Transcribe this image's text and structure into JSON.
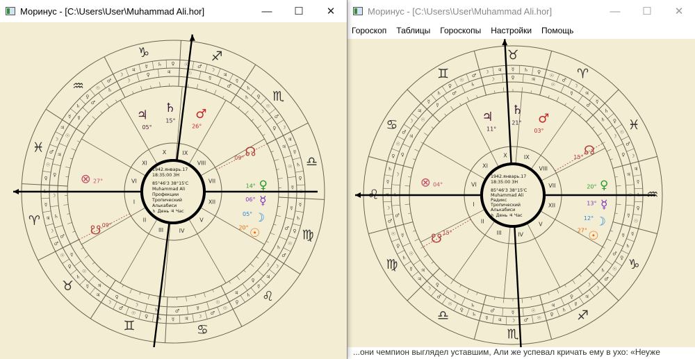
{
  "left_window": {
    "title": "Моринус - [C:\\Users\\User\\Muhammad Ali.hor]",
    "chart": {
      "date": "1942.январь.17",
      "time": "18:35:00 ЗН",
      "name": "Muhammad Ali",
      "coords": "85°46'3  38°15'C",
      "house_system": "Профекции",
      "zodiac": "Тропический",
      "extra": "Алькабиси",
      "day_hour": "♄ День  ♃ Час"
    }
  },
  "right_window": {
    "title": "Моринус - [C:\\Users\\User\\Muhammad Ali.hor]",
    "menu": [
      "Гороскоп",
      "Таблицы",
      "Гороскопы",
      "Настройки",
      "Помощь"
    ],
    "chart": {
      "date": "1942.январь.17",
      "time": "18:35:00 ЗН",
      "name": "Muhammad Ali",
      "coords": "85°46'3  38°15'C",
      "house_system": "Радикс",
      "zodiac": "Тропический",
      "extra": "Алькабиси",
      "day_hour": "♄ День  ♃ Час"
    }
  },
  "colors": {
    "chart_bg": "#f3eed3",
    "line": "#6b6252",
    "saturn": "#3a1a3a",
    "jupiter": "#4a1a3a",
    "mars": "#c62828",
    "venus": "#2e9a2e",
    "mercury": "#7b2fbf",
    "moon": "#1e88e5",
    "sun": "#ef6c00",
    "node": "#b0413e",
    "fortuna": "#c0506a"
  },
  "window_buttons": {
    "minimize": "—",
    "maximize": "☐",
    "close": "✕"
  },
  "caption_text": "...они чемпион выглядел уставшим, Али же успевал кричать ему в ухо: «Неуже"
}
